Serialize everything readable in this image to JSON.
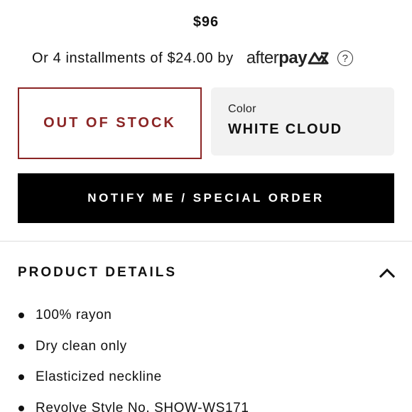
{
  "price": "$96",
  "installments": {
    "text": "Or 4 installments of $24.00 by",
    "provider": {
      "part1": "after",
      "part2": "pay"
    },
    "help": "?"
  },
  "stock_status": "OUT OF STOCK",
  "color": {
    "label": "Color",
    "value": "WHITE CLOUD"
  },
  "notify_button": "NOTIFY ME / SPECIAL ORDER",
  "product_details": {
    "title": "PRODUCT DETAILS",
    "expanded": true,
    "items": [
      "100% rayon",
      "Dry clean only",
      "Elasticized neckline",
      "Revolve Style No. SHOW-WS171"
    ]
  },
  "colors": {
    "out_of_stock": "#8b2525",
    "button_bg": "#000000",
    "color_box_bg": "#f2f2f2"
  },
  "icons": {
    "afterpay": "afterpay-logo",
    "help": "help-icon",
    "collapse": "chevron-up-icon"
  }
}
